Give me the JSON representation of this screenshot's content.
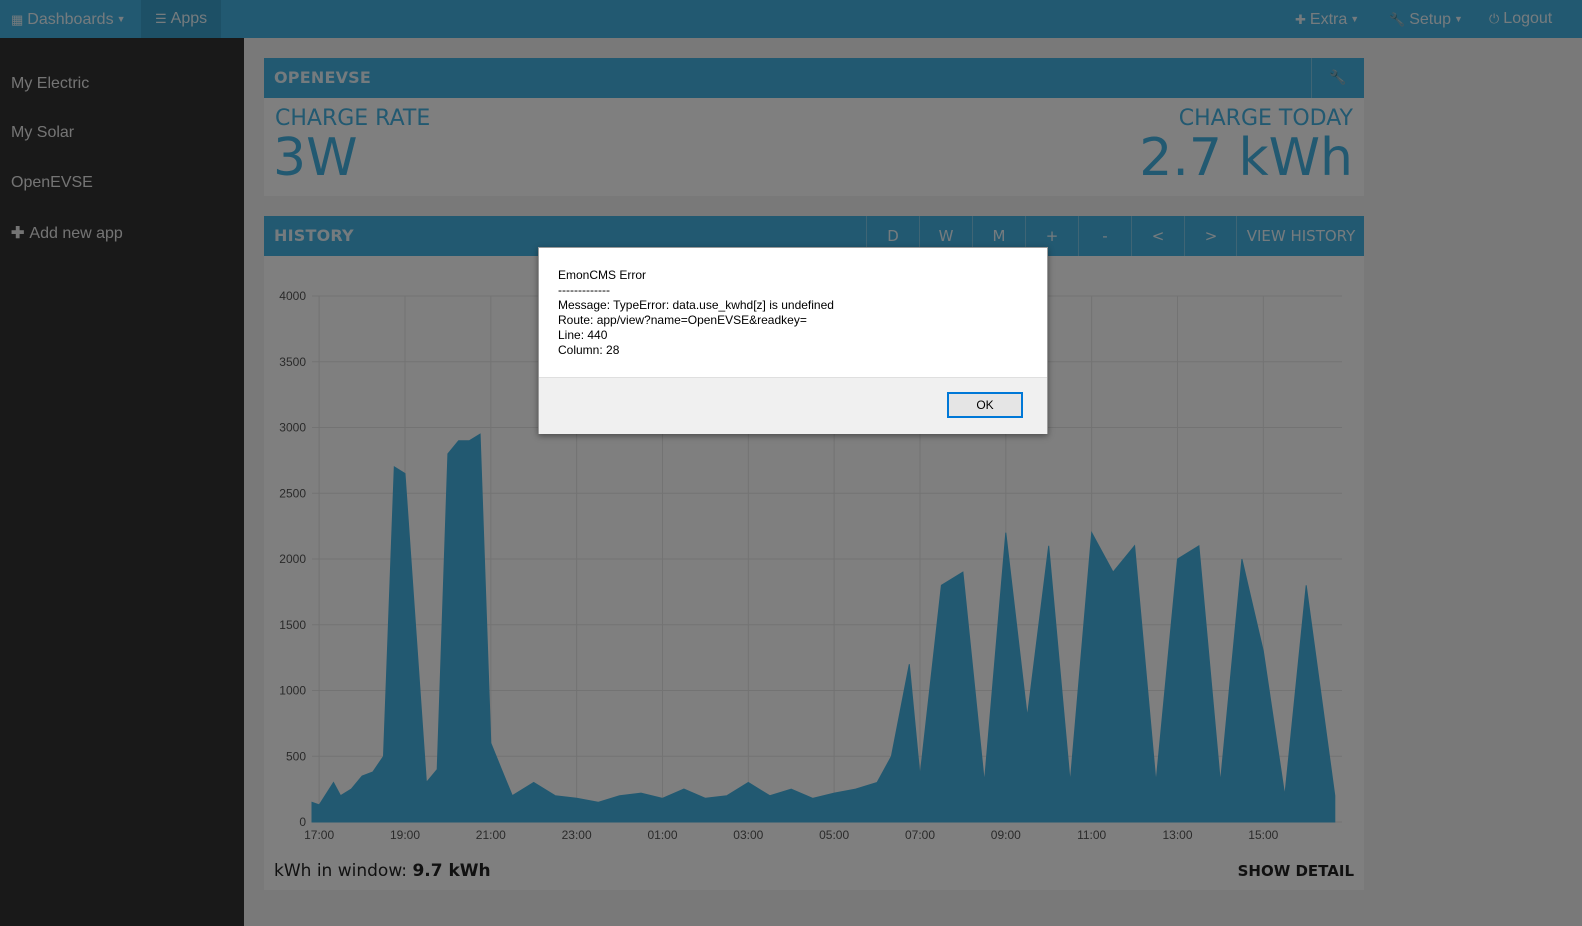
{
  "topnav": {
    "dashboards": "Dashboards",
    "apps": "Apps",
    "extra": "Extra",
    "setup": "Setup",
    "logout": "Logout"
  },
  "sidebar": {
    "items": [
      {
        "label": "My Electric"
      },
      {
        "label": "My Solar"
      },
      {
        "label": "OpenEVSE"
      },
      {
        "label": "Add new app"
      }
    ]
  },
  "openevse": {
    "title": "OPENEVSE",
    "charge_rate_label": "CHARGE RATE",
    "charge_rate_value": "3W",
    "charge_today_label": "CHARGE TODAY",
    "charge_today_value": "2.7 kWh"
  },
  "history": {
    "title": "HISTORY",
    "buttons": [
      "D",
      "W",
      "M",
      "+",
      "-",
      "<",
      ">"
    ],
    "view_history": "VIEW HISTORY",
    "kwh_label": "kWh in window:",
    "kwh_value": "9.7 kWh",
    "show_detail": "SHOW DETAIL"
  },
  "colors": {
    "accent": "#44b3e2",
    "series": "#44b3e2",
    "sidebar_bg": "#333333"
  },
  "chart_data": {
    "type": "area",
    "xlabel": "",
    "ylabel": "",
    "ylim": [
      0,
      4000
    ],
    "xlim": [
      "16:50",
      "16:50"
    ],
    "yticks": [
      "0",
      "500",
      "1000",
      "1500",
      "2000",
      "2500",
      "3000",
      "3500",
      "4000"
    ],
    "xticks": [
      "17:00",
      "19:00",
      "21:00",
      "23:00",
      "01:00",
      "03:00",
      "05:00",
      "07:00",
      "09:00",
      "11:00",
      "13:00",
      "15:00"
    ],
    "grid": true,
    "series": [
      {
        "x": [
          "16:50",
          "17:00",
          "17:20",
          "17:30",
          "17:45",
          "18:00",
          "18:15",
          "18:30",
          "18:45",
          "19:00",
          "19:30",
          "19:45",
          "20:00",
          "20:15",
          "20:30",
          "20:45",
          "21:00",
          "21:15",
          "21:30",
          "22:00",
          "22:30",
          "23:00",
          "23:30",
          "00:00",
          "00:30",
          "01:00",
          "01:30",
          "02:00",
          "02:30",
          "03:00",
          "03:30",
          "04:00",
          "04:30",
          "05:00",
          "05:30",
          "06:00",
          "06:20",
          "06:45",
          "07:00",
          "07:30",
          "08:00",
          "08:30",
          "09:00",
          "09:30",
          "10:00",
          "10:30",
          "11:00",
          "11:30",
          "12:00",
          "12:30",
          "13:00",
          "13:30",
          "14:00",
          "14:30",
          "15:00",
          "15:30",
          "16:00",
          "16:20",
          "16:40"
        ],
        "values": [
          150,
          130,
          300,
          200,
          250,
          350,
          380,
          500,
          2700,
          2650,
          300,
          400,
          2800,
          2900,
          2900,
          2950,
          600,
          400,
          200,
          300,
          200,
          180,
          150,
          200,
          220,
          180,
          250,
          180,
          200,
          300,
          200,
          250,
          180,
          220,
          250,
          300,
          500,
          1200,
          350,
          1800,
          1900,
          300,
          2200,
          800,
          2100,
          300,
          2200,
          1900,
          2100,
          300,
          2000,
          2100,
          300,
          2000,
          1300,
          200,
          1800,
          1000,
          200
        ]
      }
    ]
  },
  "dialog": {
    "title": "EmonCMS Error",
    "separator": "-------------",
    "message": "Message: TypeError: data.use_kwhd[z] is undefined",
    "route": "Route: app/view?name=OpenEVSE&readkey=",
    "line": "Line: 440",
    "column": "Column: 28",
    "ok": "OK"
  }
}
